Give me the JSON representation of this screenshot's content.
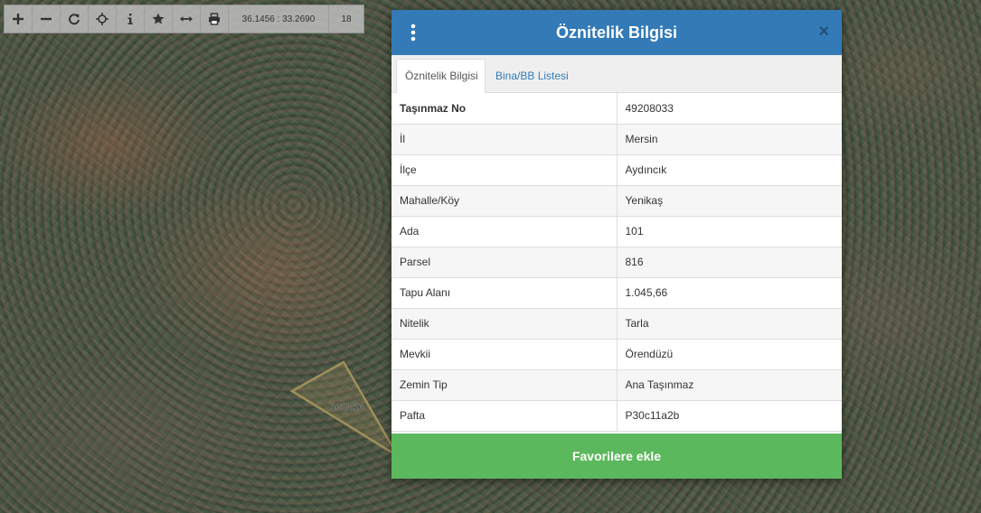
{
  "toolbar": {
    "zoom_in_icon": "plus-icon",
    "zoom_out_icon": "minus-icon",
    "refresh_icon": "refresh-icon",
    "locate_icon": "crosshair-icon",
    "info_icon": "info-icon",
    "favorite_icon": "star-icon",
    "measure_icon": "arrows-horizontal-icon",
    "print_icon": "print-icon",
    "coordinates": "36.1456 : 33.2690",
    "zoom_level": "18"
  },
  "map": {
    "parcel_label": "101/816",
    "parcel_color": "#a08f5a"
  },
  "modal": {
    "title": "Öznitelik Bilgisi",
    "close_label": "×",
    "header_color": "#337ab7",
    "tabs": [
      {
        "label": "Öznitelik Bilgisi",
        "active": true
      },
      {
        "label": "Bina/BB Listesi",
        "active": false
      }
    ],
    "rows": [
      {
        "key": "Taşınmaz No",
        "value": "49208033"
      },
      {
        "key": "İl",
        "value": "Mersin"
      },
      {
        "key": "İlçe",
        "value": "Aydıncık"
      },
      {
        "key": "Mahalle/Köy",
        "value": "Yenikaş"
      },
      {
        "key": "Ada",
        "value": "101"
      },
      {
        "key": "Parsel",
        "value": "816"
      },
      {
        "key": "Tapu Alanı",
        "value": "1.045,66"
      },
      {
        "key": "Nitelik",
        "value": "Tarla"
      },
      {
        "key": "Mevkii",
        "value": "Örendüzü"
      },
      {
        "key": "Zemin Tip",
        "value": "Ana Taşınmaz"
      },
      {
        "key": "Pafta",
        "value": "P30c11a2b"
      }
    ],
    "favorite_button": "Favorilere ekle",
    "favorite_color": "#5cb85c"
  }
}
